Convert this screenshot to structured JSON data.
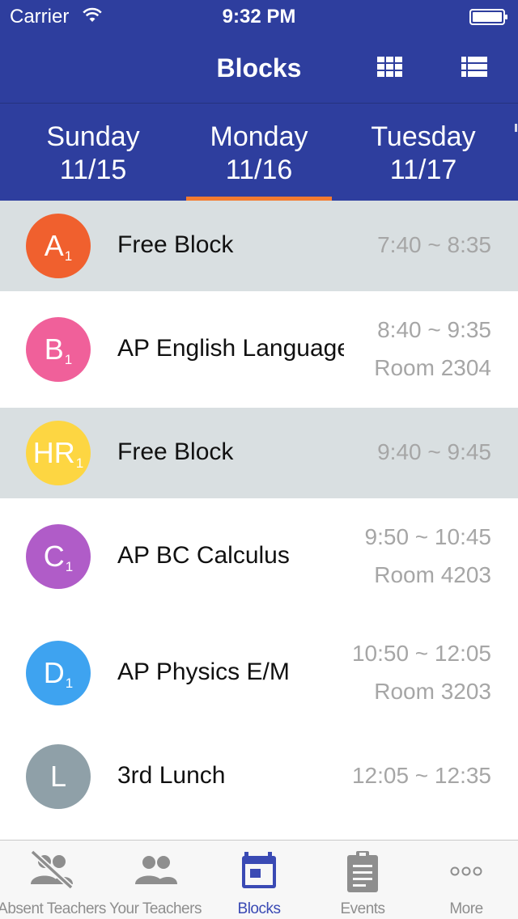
{
  "status_bar": {
    "carrier": "Carrier",
    "time": "9:32 PM"
  },
  "nav": {
    "title": "Blocks",
    "grid_icon": "grid-view-icon",
    "list_icon": "list-view-icon"
  },
  "days": [
    {
      "name": "Sunday",
      "date": "11/15",
      "selected": false
    },
    {
      "name": "Monday",
      "date": "11/16",
      "selected": true
    },
    {
      "name": "Tuesday",
      "date": "11/17",
      "selected": false
    }
  ],
  "colors": {
    "nav_background": "#2e3e9e",
    "tab_indicator": "#f47b30",
    "active_tab": "#3a4ab4",
    "dim_row": "#d9dfe1"
  },
  "blocks": [
    {
      "letter": "A",
      "sub": "1",
      "color": "#f0602e",
      "name": "Free Block",
      "time": "7:40 ~ 8:35",
      "room": "",
      "dim": true
    },
    {
      "letter": "B",
      "sub": "1",
      "color": "#f0609a",
      "name": "AP English Language",
      "time": "8:40 ~ 9:35",
      "room": "Room 2304",
      "dim": false
    },
    {
      "letter": "HR",
      "sub": "1",
      "color": "#fdd642",
      "name": "Free Block",
      "time": "9:40 ~ 9:45",
      "room": "",
      "dim": true
    },
    {
      "letter": "C",
      "sub": "1",
      "color": "#b05cc8",
      "name": "AP BC Calculus",
      "time": "9:50 ~ 10:45",
      "room": "Room 4203",
      "dim": false
    },
    {
      "letter": "D",
      "sub": "1",
      "color": "#3ea3f0",
      "name": "AP Physics E/M",
      "time": "10:50 ~ 12:05",
      "room": "Room 3203",
      "dim": false
    },
    {
      "letter": "L",
      "sub": "",
      "color": "#8fa0a8",
      "name": "3rd Lunch",
      "time": "12:05 ~ 12:35",
      "room": "",
      "dim": false
    }
  ],
  "tabs": [
    {
      "label": "Absent Teachers",
      "icon": "absent-teachers-icon",
      "active": false
    },
    {
      "label": "Your Teachers",
      "icon": "your-teachers-icon",
      "active": false
    },
    {
      "label": "Blocks",
      "icon": "calendar-icon",
      "active": true
    },
    {
      "label": "Events",
      "icon": "clipboard-icon",
      "active": false
    },
    {
      "label": "More",
      "icon": "more-icon",
      "active": false
    }
  ]
}
